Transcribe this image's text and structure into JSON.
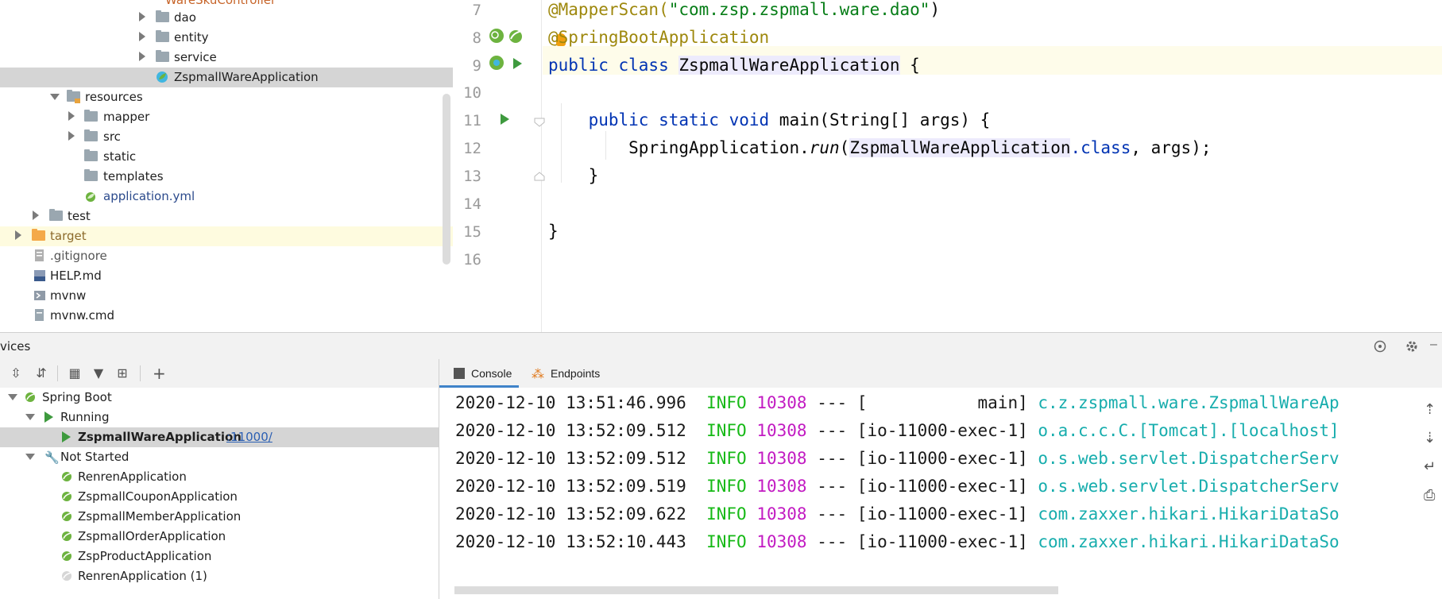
{
  "project_tree": {
    "items": [
      {
        "label": "dao",
        "type": "folder"
      },
      {
        "label": "entity",
        "type": "folder"
      },
      {
        "label": "service",
        "type": "folder"
      },
      {
        "label": "ZspmallWareApplication",
        "type": "spring-class"
      },
      {
        "label": "resources",
        "type": "resources-folder"
      },
      {
        "label": "mapper",
        "type": "folder"
      },
      {
        "label": "src",
        "type": "folder"
      },
      {
        "label": "static",
        "type": "folder"
      },
      {
        "label": "templates",
        "type": "folder"
      },
      {
        "label": "application.yml",
        "type": "yml"
      },
      {
        "label": "test",
        "type": "folder"
      },
      {
        "label": "target",
        "type": "folder-orange"
      },
      {
        "label": ".gitignore",
        "type": "file"
      },
      {
        "label": "HELP.md",
        "type": "md"
      },
      {
        "label": "mvnw",
        "type": "file"
      },
      {
        "label": "mvnw.cmd",
        "type": "file"
      }
    ]
  },
  "editor": {
    "line_numbers": [
      "7",
      "8",
      "9",
      "10",
      "11",
      "12",
      "13",
      "14",
      "15",
      "16"
    ],
    "lines": {
      "l7_ann": "@MapperScan(",
      "l7_str": "\"com.zsp.zspmall.ware.dao\"",
      "l7_end": ")",
      "l8_at": "@",
      "l8_ann": "SpringBootApplication",
      "l9_kw": "public class ",
      "l9_cls": "ZspmallWareApplication",
      "l9_end": " {",
      "l11_kw": "public static void ",
      "l11_rest": "main(String[] args) {",
      "l12_a": "SpringApplication.",
      "l12_b": "run",
      "l12_c": "(",
      "l12_d": "ZspmallWareApplication",
      "l12_e": ".class",
      "l12_f": ", args);",
      "l13": "}",
      "l15": "}"
    }
  },
  "services": {
    "title": "vices",
    "tree": {
      "root": "Spring Boot",
      "running_group": "Running",
      "running_app": "ZspmallWareApplication",
      "running_port": ":11000/",
      "not_started_group": "Not Started",
      "not_started": [
        "RenrenApplication",
        "ZspmallCouponApplication",
        "ZspmallMemberApplication",
        "ZspmallOrderApplication",
        "ZspProductApplication",
        "RenrenApplication (1)"
      ]
    },
    "tabs": {
      "console": "Console",
      "endpoints": "Endpoints"
    }
  },
  "console": {
    "lines": [
      {
        "ts": "2020-12-10 13:51:46.996",
        "level": "INFO",
        "pid": "10308",
        "sep": "---",
        "thread": "[           main]",
        "logger": "c.z.zspmall.ware.ZspmallWareAp"
      },
      {
        "ts": "2020-12-10 13:52:09.512",
        "level": "INFO",
        "pid": "10308",
        "sep": "---",
        "thread": "[io-11000-exec-1]",
        "logger": "o.a.c.c.C.[Tomcat].[localhost]"
      },
      {
        "ts": "2020-12-10 13:52:09.512",
        "level": "INFO",
        "pid": "10308",
        "sep": "---",
        "thread": "[io-11000-exec-1]",
        "logger": "o.s.web.servlet.DispatcherServ"
      },
      {
        "ts": "2020-12-10 13:52:09.519",
        "level": "INFO",
        "pid": "10308",
        "sep": "---",
        "thread": "[io-11000-exec-1]",
        "logger": "o.s.web.servlet.DispatcherServ"
      },
      {
        "ts": "2020-12-10 13:52:09.622",
        "level": "INFO",
        "pid": "10308",
        "sep": "---",
        "thread": "[io-11000-exec-1]",
        "logger": "com.zaxxer.hikari.HikariDataSo"
      },
      {
        "ts": "2020-12-10 13:52:10.443",
        "level": "INFO",
        "pid": "10308",
        "sep": "---",
        "thread": "[io-11000-exec-1]",
        "logger": "com.zaxxer.hikari.HikariDataSo"
      }
    ]
  },
  "colors": {
    "keyword": "#0033b3",
    "annotation": "#9e880d",
    "string": "#067d17",
    "log_info": "#16b916",
    "log_pid": "#c21bc2",
    "log_logger": "#17adad",
    "link": "#2b5fb3"
  }
}
